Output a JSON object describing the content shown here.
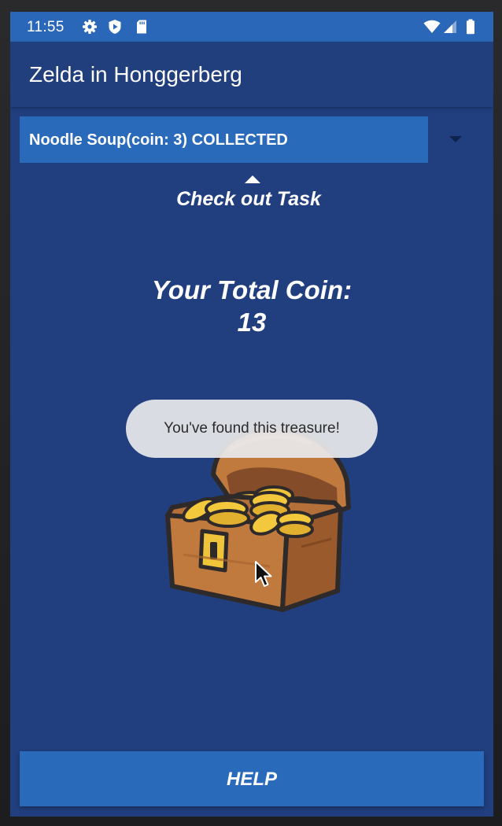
{
  "status_bar": {
    "time": "11:55",
    "icons": [
      "gear-icon",
      "shield-play-icon",
      "sd-card-icon",
      "wifi-icon",
      "signal-icon",
      "battery-icon"
    ]
  },
  "app_bar": {
    "title": "Zelda in Honggerberg"
  },
  "task_spinner": {
    "selected": "Noodle Soup(coin: 3) COLLECTED"
  },
  "check_task_label": "Check out Task",
  "coins": {
    "label": "Your Total Coin:",
    "value": "13"
  },
  "toast": {
    "message": "You've found this treasure!"
  },
  "help_button": {
    "label": "HELP"
  },
  "colors": {
    "primary": "#2a6abb",
    "background": "#213f7d",
    "status_bar": "#2a67b8",
    "text": "#ffffff"
  }
}
